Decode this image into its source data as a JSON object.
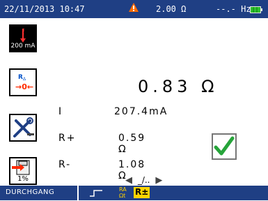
{
  "status_bar": {
    "datetime": "22/11/2013 10:47",
    "warning_icon": "warning-triangle-icon",
    "resistance": "2.00 Ω",
    "frequency": "--.- Hz",
    "battery_icon": "battery-icon"
  },
  "sidebar": {
    "current_label": "200 mA",
    "zero_icon": "zero-lead-icon",
    "tools_icon": "tools-icon",
    "save_percent": "1%"
  },
  "measurement": {
    "main_value": "0.83 Ω",
    "rows": [
      {
        "label": "I",
        "value": "207.4mA"
      },
      {
        "label": "R+",
        "value": "0.59 Ω"
      },
      {
        "label": "R-",
        "value": "1.08 Ω"
      }
    ],
    "result_icon": "checkmark-icon"
  },
  "nav": {
    "page": "_/.."
  },
  "bottom_bar": {
    "mode": "DURCHGANG",
    "ra_label_top": "RA",
    "ra_label_bottom": "Ωt",
    "rpm_label": "R±"
  },
  "colors": {
    "bar_bg": "#1f3f84",
    "accent_yellow": "#ffd400",
    "check_green": "#26a43a",
    "warning_orange": "#ff6b00"
  }
}
